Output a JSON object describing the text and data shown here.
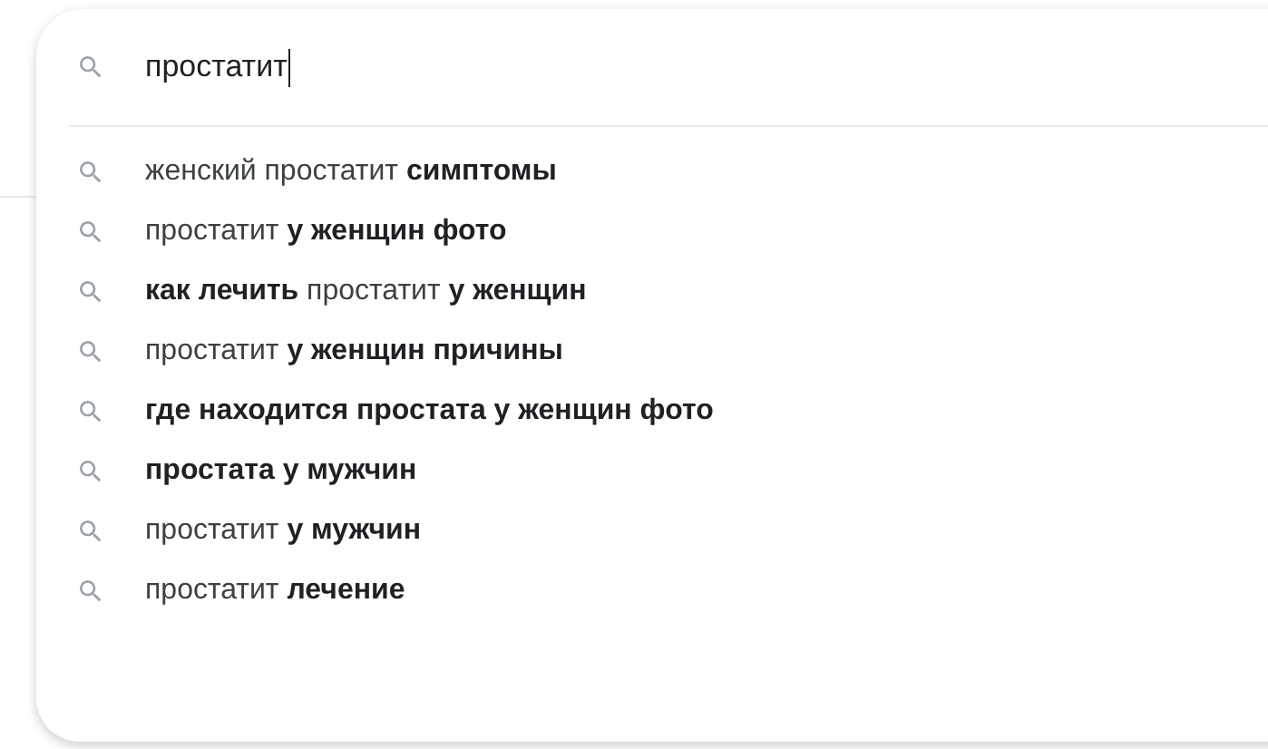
{
  "search": {
    "value": "простатит"
  },
  "suggestions": [
    "женский простатит **симптомы**",
    "простатит **у женщин фото**",
    "**как лечить** простатит **у женщин**",
    "простатит **у женщин причины**",
    "**где находится простата у женщин фото**",
    "**простата у мужчин**",
    "простатит **у мужчин**",
    "простатит **лечение**"
  ]
}
